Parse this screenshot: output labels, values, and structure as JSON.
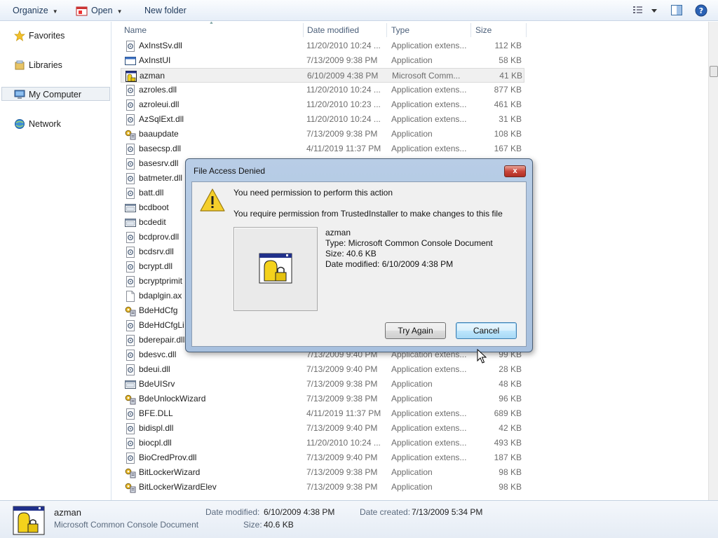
{
  "toolbar": {
    "organize_label": "Organize",
    "open_label": "Open",
    "new_folder_label": "New folder"
  },
  "nav": {
    "favorites": "Favorites",
    "libraries": "Libraries",
    "my_computer": "My Computer",
    "network": "Network"
  },
  "list": {
    "columns": {
      "name": "Name",
      "date": "Date modified",
      "type": "Type",
      "size": "Size"
    },
    "rows": [
      {
        "icon": "dll-icon",
        "name": "AxInstSv.dll",
        "date": "11/20/2010 10:24 ...",
        "type": "Application extens...",
        "size": "112 KB"
      },
      {
        "icon": "window-exe-icon",
        "name": "AxInstUI",
        "date": "7/13/2009 9:38 PM",
        "type": "Application",
        "size": "58 KB"
      },
      {
        "icon": "msc-icon",
        "name": "azman",
        "date": "6/10/2009 4:38 PM",
        "type": "Microsoft Comm...",
        "size": "41 KB",
        "selected": true
      },
      {
        "icon": "dll-icon",
        "name": "azroles.dll",
        "date": "11/20/2010 10:24 ...",
        "type": "Application extens...",
        "size": "877 KB"
      },
      {
        "icon": "dll-icon",
        "name": "azroleui.dll",
        "date": "11/20/2010 10:23 ...",
        "type": "Application extens...",
        "size": "461 KB"
      },
      {
        "icon": "dll-icon",
        "name": "AzSqlExt.dll",
        "date": "11/20/2010 10:24 ...",
        "type": "Application extens...",
        "size": "31 KB"
      },
      {
        "icon": "exe-gear-icon",
        "name": "baaupdate",
        "date": "7/13/2009 9:38 PM",
        "type": "Application",
        "size": "108 KB"
      },
      {
        "icon": "dll-icon",
        "name": "basecsp.dll",
        "date": "4/11/2019 11:37 PM",
        "type": "Application extens...",
        "size": "167 KB"
      },
      {
        "icon": "dll-icon",
        "name": "basesrv.dll",
        "date": "",
        "type": "",
        "size": ""
      },
      {
        "icon": "dll-icon",
        "name": "batmeter.dll",
        "date": "",
        "type": "",
        "size": ""
      },
      {
        "icon": "dll-icon",
        "name": "batt.dll",
        "date": "",
        "type": "",
        "size": ""
      },
      {
        "icon": "console-icon",
        "name": "bcdboot",
        "date": "",
        "type": "",
        "size": ""
      },
      {
        "icon": "console-icon",
        "name": "bcdedit",
        "date": "",
        "type": "",
        "size": ""
      },
      {
        "icon": "dll-icon",
        "name": "bcdprov.dll",
        "date": "",
        "type": "",
        "size": ""
      },
      {
        "icon": "dll-icon",
        "name": "bcdsrv.dll",
        "date": "",
        "type": "",
        "size": ""
      },
      {
        "icon": "dll-icon",
        "name": "bcrypt.dll",
        "date": "",
        "type": "",
        "size": ""
      },
      {
        "icon": "dll-icon",
        "name": "bcryptprimit",
        "date": "",
        "type": "",
        "size": ""
      },
      {
        "icon": "blank-file-icon",
        "name": "bdaplgin.ax",
        "date": "",
        "type": "",
        "size": ""
      },
      {
        "icon": "exe-gear-icon",
        "name": "BdeHdCfg",
        "date": "",
        "type": "",
        "size": ""
      },
      {
        "icon": "dll-icon",
        "name": "BdeHdCfgLi",
        "date": "",
        "type": "",
        "size": ""
      },
      {
        "icon": "dll-icon",
        "name": "bderepair.dll",
        "date": "",
        "type": "",
        "size": ""
      },
      {
        "icon": "dll-icon",
        "name": "bdesvc.dll",
        "date": "7/13/2009 9:40 PM",
        "type": "Application extens...",
        "size": "99 KB"
      },
      {
        "icon": "dll-icon",
        "name": "bdeui.dll",
        "date": "7/13/2009 9:40 PM",
        "type": "Application extens...",
        "size": "28 KB"
      },
      {
        "icon": "console-icon",
        "name": "BdeUISrv",
        "date": "7/13/2009 9:38 PM",
        "type": "Application",
        "size": "48 KB"
      },
      {
        "icon": "exe-gear-icon",
        "name": "BdeUnlockWizard",
        "date": "7/13/2009 9:38 PM",
        "type": "Application",
        "size": "96 KB"
      },
      {
        "icon": "dll-icon",
        "name": "BFE.DLL",
        "date": "4/11/2019 11:37 PM",
        "type": "Application extens...",
        "size": "689 KB"
      },
      {
        "icon": "dll-icon",
        "name": "bidispl.dll",
        "date": "7/13/2009 9:40 PM",
        "type": "Application extens...",
        "size": "42 KB"
      },
      {
        "icon": "dll-icon",
        "name": "biocpl.dll",
        "date": "11/20/2010 10:24 ...",
        "type": "Application extens...",
        "size": "493 KB"
      },
      {
        "icon": "dll-icon",
        "name": "BioCredProv.dll",
        "date": "7/13/2009 9:40 PM",
        "type": "Application extens...",
        "size": "187 KB"
      },
      {
        "icon": "exe-gear-icon",
        "name": "BitLockerWizard",
        "date": "7/13/2009 9:38 PM",
        "type": "Application",
        "size": "98 KB"
      },
      {
        "icon": "exe-gear-icon",
        "name": "BitLockerWizardElev",
        "date": "7/13/2009 9:38 PM",
        "type": "Application",
        "size": "98 KB"
      }
    ]
  },
  "details": {
    "name": "azman",
    "type": "Microsoft Common Console Document",
    "date_modified_label": "Date modified:",
    "date_modified": "6/10/2009 4:38 PM",
    "date_created_label": "Date created:",
    "date_created": "7/13/2009 5:34 PM",
    "size_label": "Size:",
    "size": "40.6 KB"
  },
  "dialog": {
    "title": "File Access Denied",
    "close_label": "x",
    "message": "You need permission to perform this action",
    "detail": "You require permission from TrustedInstaller to make changes to this file",
    "file_name": "azman",
    "file_type": "Type: Microsoft Common Console Document",
    "file_size": "Size: 40.6 KB",
    "file_date": "Date modified: 6/10/2009 4:38 PM",
    "try_again_label": "Try Again",
    "cancel_label": "Cancel"
  },
  "colors": {
    "accent": "#1e395b",
    "dialog_frame": "#b8cde6",
    "close_red": "#c9463a"
  }
}
